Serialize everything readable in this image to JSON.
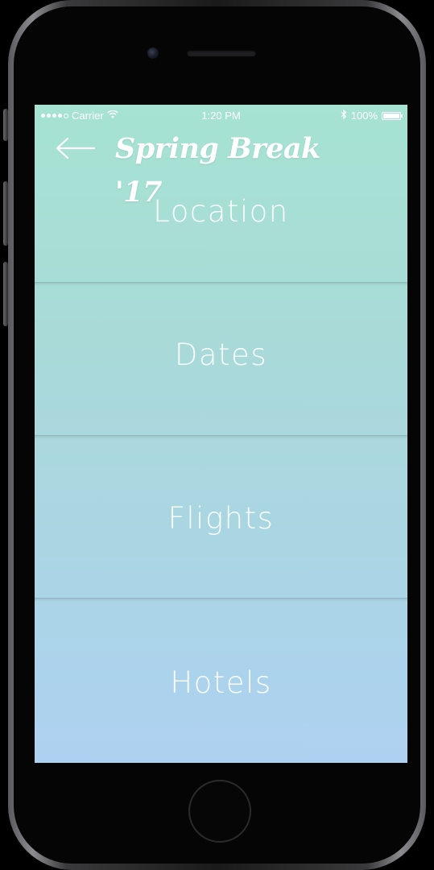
{
  "status_bar": {
    "carrier": "Carrier",
    "time": "1:20 PM",
    "battery": "100%"
  },
  "nav": {
    "title": "Spring Break '17",
    "back_icon": "arrow-left-icon"
  },
  "menu": {
    "items": [
      {
        "label": "Location"
      },
      {
        "label": "Dates"
      },
      {
        "label": "Flights"
      },
      {
        "label": "Hotels"
      }
    ]
  },
  "colors": {
    "gradient_top": "#a6e3d2",
    "gradient_bottom": "#aed1f1",
    "text": "#ffffff"
  }
}
